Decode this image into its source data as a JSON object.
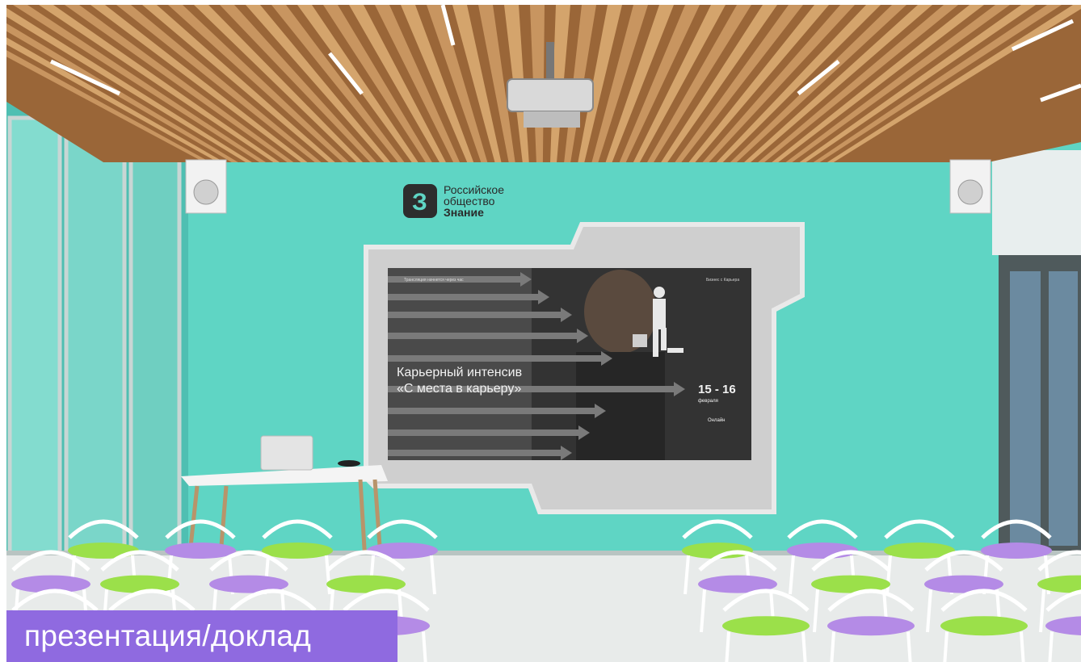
{
  "logo": {
    "line1": "Российское",
    "line2": "общество",
    "line3": "Знание"
  },
  "screen": {
    "top_left_note": "Трансляция начнется через час",
    "top_right_note": "Бизнес с Карьера",
    "title_line1": "Карьерный интенсив",
    "title_line2": "«С места в карьеру»",
    "dates": "15 - 16",
    "month": "февраля",
    "format": "Онлайн"
  },
  "caption": "презентация/доклад",
  "colors": {
    "wall": "#5fd5c4",
    "ceiling_wood": "#b07a48",
    "caption_bg": "#8f6ae0",
    "seat_green": "#9be04a",
    "seat_purple": "#b48be6"
  }
}
